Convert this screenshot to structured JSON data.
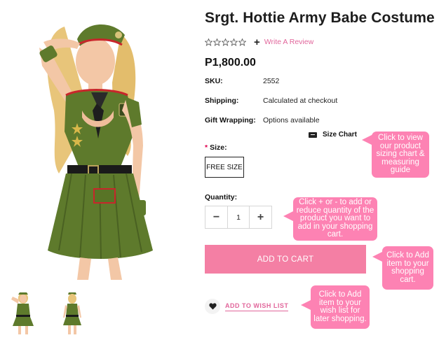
{
  "product": {
    "title": "Srgt. Hottie Army Babe Costume",
    "rating_stars": 5,
    "write_review": "Write A Review",
    "price": "P1,800.00"
  },
  "details": {
    "sku_label": "SKU:",
    "sku_value": "2552",
    "shipping_label": "Shipping:",
    "shipping_value": "Calculated at checkout",
    "gift_label": "Gift Wrapping:",
    "gift_value": "Options available"
  },
  "size": {
    "chart_label": "Size Chart",
    "required_mark": "*",
    "label": "Size:",
    "option": "FREE SIZE"
  },
  "quantity": {
    "label": "Quantity:",
    "value": "1",
    "minus": "−",
    "plus": "+"
  },
  "actions": {
    "add_to_cart": "ADD TO CART",
    "add_to_wishlist": "ADD TO WISH LIST"
  },
  "callouts": {
    "size_chart": "Click to view our product sizing chart & measuring guide",
    "quantity": "Click + or - to add or reduce quantity of the product you want to add in your shopping cart.",
    "add_to_cart": "Click to Add item to your shopping cart.",
    "wishlist": "Click to Add item to your wish list for later shopping."
  },
  "colors": {
    "accent_pink": "#f47fa4",
    "callout_pink": "#fd82b3",
    "link_pink": "#e1669b",
    "costume_green": "#5e7a2c",
    "costume_red": "#c8262b"
  }
}
